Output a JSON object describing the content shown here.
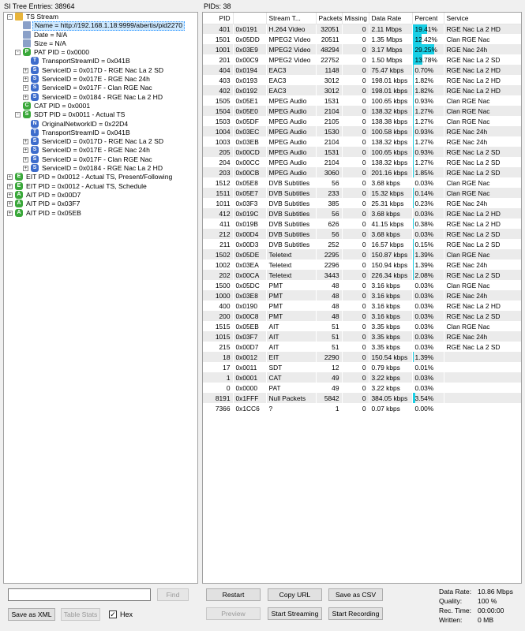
{
  "left_header": "SI Tree Entries: 38964",
  "right_header": "PIDs: 38",
  "tree": [
    {
      "indent": 0,
      "exp": "-",
      "icon": "folder",
      "icon_text": "",
      "label": "TS Stream",
      "name": "tree-ts-stream"
    },
    {
      "indent": 1,
      "exp": "",
      "icon": "doc",
      "icon_text": "",
      "label": "Name = http://192.168.1.18:9999/abertis/pid2270",
      "selected": true,
      "name": "tree-name"
    },
    {
      "indent": 1,
      "exp": "",
      "icon": "doc",
      "icon_text": "",
      "label": "Date = N/A",
      "name": "tree-date"
    },
    {
      "indent": 1,
      "exp": "",
      "icon": "doc",
      "icon_text": "",
      "label": "Size = N/A",
      "name": "tree-size"
    },
    {
      "indent": 1,
      "exp": "-",
      "icon": "green",
      "icon_text": "P",
      "label": "PAT PID = 0x0000",
      "name": "tree-pat"
    },
    {
      "indent": 2,
      "exp": "",
      "icon": "blue",
      "icon_text": "T",
      "label": "TransportStreamID = 0x041B",
      "name": "tree-pat-tsid"
    },
    {
      "indent": 2,
      "exp": "+",
      "icon": "blue",
      "icon_text": "S",
      "label": "ServiceID = 0x017D - RGE Nac La 2 SD",
      "name": "tree-pat-service"
    },
    {
      "indent": 2,
      "exp": "+",
      "icon": "blue",
      "icon_text": "S",
      "label": "ServiceID = 0x017E - RGE Nac 24h",
      "name": "tree-pat-service"
    },
    {
      "indent": 2,
      "exp": "+",
      "icon": "blue",
      "icon_text": "S",
      "label": "ServiceID = 0x017F - Clan RGE Nac",
      "name": "tree-pat-service"
    },
    {
      "indent": 2,
      "exp": "+",
      "icon": "blue",
      "icon_text": "S",
      "label": "ServiceID = 0x0184 - RGE Nac La 2 HD",
      "name": "tree-pat-service"
    },
    {
      "indent": 1,
      "exp": "",
      "icon": "green",
      "icon_text": "C",
      "label": "CAT PID = 0x0001",
      "name": "tree-cat"
    },
    {
      "indent": 1,
      "exp": "-",
      "icon": "green",
      "icon_text": "S",
      "label": "SDT PID = 0x0011 - Actual TS",
      "name": "tree-sdt"
    },
    {
      "indent": 2,
      "exp": "",
      "icon": "blue",
      "icon_text": "N",
      "label": "OriginalNetworkID = 0x22D4",
      "name": "tree-sdt-onid"
    },
    {
      "indent": 2,
      "exp": "",
      "icon": "blue",
      "icon_text": "T",
      "label": "TransportStreamID = 0x041B",
      "name": "tree-sdt-tsid"
    },
    {
      "indent": 2,
      "exp": "+",
      "icon": "blue",
      "icon_text": "S",
      "label": "ServiceID = 0x017D - RGE Nac La 2 SD",
      "name": "tree-sdt-service"
    },
    {
      "indent": 2,
      "exp": "+",
      "icon": "blue",
      "icon_text": "S",
      "label": "ServiceID = 0x017E - RGE Nac 24h",
      "name": "tree-sdt-service"
    },
    {
      "indent": 2,
      "exp": "+",
      "icon": "blue",
      "icon_text": "S",
      "label": "ServiceID = 0x017F - Clan RGE Nac",
      "name": "tree-sdt-service"
    },
    {
      "indent": 2,
      "exp": "+",
      "icon": "blue",
      "icon_text": "S",
      "label": "ServiceID = 0x0184 - RGE Nac La 2 HD",
      "name": "tree-sdt-service"
    },
    {
      "indent": 0,
      "exp": "+",
      "icon": "green",
      "icon_text": "E",
      "label": "EIT PID = 0x0012 - Actual TS, Present/Following",
      "name": "tree-eit-pf"
    },
    {
      "indent": 0,
      "exp": "+",
      "icon": "green",
      "icon_text": "E",
      "label": "EIT PID = 0x0012 - Actual TS, Schedule",
      "name": "tree-eit-schedule"
    },
    {
      "indent": 0,
      "exp": "+",
      "icon": "green",
      "icon_text": "A",
      "label": "AIT PID = 0x00D7",
      "name": "tree-ait"
    },
    {
      "indent": 0,
      "exp": "+",
      "icon": "green",
      "icon_text": "A",
      "label": "AIT PID = 0x03F7",
      "name": "tree-ait"
    },
    {
      "indent": 0,
      "exp": "+",
      "icon": "green",
      "icon_text": "A",
      "label": "AIT PID = 0x05EB",
      "name": "tree-ait"
    }
  ],
  "table": {
    "columns": [
      "PID",
      "",
      "Stream T...",
      "Packets",
      "Missing",
      "Data Rate",
      "Percent",
      "Service"
    ],
    "rows": [
      [
        "401",
        "0x0191",
        "H.264 Video",
        "32051",
        "0",
        "2.11 Mbps",
        "19.41%",
        "RGE Nac La 2 HD"
      ],
      [
        "1501",
        "0x05DD",
        "MPEG2 Video",
        "20511",
        "0",
        "1.35 Mbps",
        "12.42%",
        "Clan RGE Nac"
      ],
      [
        "1001",
        "0x03E9",
        "MPEG2 Video",
        "48294",
        "0",
        "3.17 Mbps",
        "29.25%",
        "RGE Nac 24h"
      ],
      [
        "201",
        "0x00C9",
        "MPEG2 Video",
        "22752",
        "0",
        "1.50 Mbps",
        "13.78%",
        "RGE Nac La 2 SD"
      ],
      [
        "404",
        "0x0194",
        "EAC3",
        "1148",
        "0",
        "75.47 kbps",
        "0.70%",
        "RGE Nac La 2 HD"
      ],
      [
        "403",
        "0x0193",
        "EAC3",
        "3012",
        "0",
        "198.01 kbps",
        "1.82%",
        "RGE Nac La 2 HD"
      ],
      [
        "402",
        "0x0192",
        "EAC3",
        "3012",
        "0",
        "198.01 kbps",
        "1.82%",
        "RGE Nac La 2 HD"
      ],
      [
        "1505",
        "0x05E1",
        "MPEG Audio",
        "1531",
        "0",
        "100.65 kbps",
        "0.93%",
        "Clan RGE Nac"
      ],
      [
        "1504",
        "0x05E0",
        "MPEG Audio",
        "2104",
        "0",
        "138.32 kbps",
        "1.27%",
        "Clan RGE Nac"
      ],
      [
        "1503",
        "0x05DF",
        "MPEG Audio",
        "2105",
        "0",
        "138.38 kbps",
        "1.27%",
        "Clan RGE Nac"
      ],
      [
        "1004",
        "0x03EC",
        "MPEG Audio",
        "1530",
        "0",
        "100.58 kbps",
        "0.93%",
        "RGE Nac 24h"
      ],
      [
        "1003",
        "0x03EB",
        "MPEG Audio",
        "2104",
        "0",
        "138.32 kbps",
        "1.27%",
        "RGE Nac 24h"
      ],
      [
        "205",
        "0x00CD",
        "MPEG Audio",
        "1531",
        "0",
        "100.65 kbps",
        "0.93%",
        "RGE Nac La 2 SD"
      ],
      [
        "204",
        "0x00CC",
        "MPEG Audio",
        "2104",
        "0",
        "138.32 kbps",
        "1.27%",
        "RGE Nac La 2 SD"
      ],
      [
        "203",
        "0x00CB",
        "MPEG Audio",
        "3060",
        "0",
        "201.16 kbps",
        "1.85%",
        "RGE Nac La 2 SD"
      ],
      [
        "1512",
        "0x05E8",
        "DVB Subtitles",
        "56",
        "0",
        "3.68 kbps",
        "0.03%",
        "Clan RGE Nac"
      ],
      [
        "1511",
        "0x05E7",
        "DVB Subtitles",
        "233",
        "0",
        "15.32 kbps",
        "0.14%",
        "Clan RGE Nac"
      ],
      [
        "1011",
        "0x03F3",
        "DVB Subtitles",
        "385",
        "0",
        "25.31 kbps",
        "0.23%",
        "RGE Nac 24h"
      ],
      [
        "412",
        "0x019C",
        "DVB Subtitles",
        "56",
        "0",
        "3.68 kbps",
        "0.03%",
        "RGE Nac La 2 HD"
      ],
      [
        "411",
        "0x019B",
        "DVB Subtitles",
        "626",
        "0",
        "41.15 kbps",
        "0.38%",
        "RGE Nac La 2 HD"
      ],
      [
        "212",
        "0x00D4",
        "DVB Subtitles",
        "56",
        "0",
        "3.68 kbps",
        "0.03%",
        "RGE Nac La 2 SD"
      ],
      [
        "211",
        "0x00D3",
        "DVB Subtitles",
        "252",
        "0",
        "16.57 kbps",
        "0.15%",
        "RGE Nac La 2 SD"
      ],
      [
        "1502",
        "0x05DE",
        "Teletext",
        "2295",
        "0",
        "150.87 kbps",
        "1.39%",
        "Clan RGE Nac"
      ],
      [
        "1002",
        "0x03EA",
        "Teletext",
        "2296",
        "0",
        "150.94 kbps",
        "1.39%",
        "RGE Nac 24h"
      ],
      [
        "202",
        "0x00CA",
        "Teletext",
        "3443",
        "0",
        "226.34 kbps",
        "2.08%",
        "RGE Nac La 2 SD"
      ],
      [
        "1500",
        "0x05DC",
        "PMT",
        "48",
        "0",
        "3.16 kbps",
        "0.03%",
        "Clan RGE Nac"
      ],
      [
        "1000",
        "0x03E8",
        "PMT",
        "48",
        "0",
        "3.16 kbps",
        "0.03%",
        "RGE Nac 24h"
      ],
      [
        "400",
        "0x0190",
        "PMT",
        "48",
        "0",
        "3.16 kbps",
        "0.03%",
        "RGE Nac La 2 HD"
      ],
      [
        "200",
        "0x00C8",
        "PMT",
        "48",
        "0",
        "3.16 kbps",
        "0.03%",
        "RGE Nac La 2 SD"
      ],
      [
        "1515",
        "0x05EB",
        "AIT",
        "51",
        "0",
        "3.35 kbps",
        "0.03%",
        "Clan RGE Nac"
      ],
      [
        "1015",
        "0x03F7",
        "AIT",
        "51",
        "0",
        "3.35 kbps",
        "0.03%",
        "RGE Nac 24h"
      ],
      [
        "215",
        "0x00D7",
        "AIT",
        "51",
        "0",
        "3.35 kbps",
        "0.03%",
        "RGE Nac La 2 SD"
      ],
      [
        "18",
        "0x0012",
        "EIT",
        "2290",
        "0",
        "150.54 kbps",
        "1.39%",
        ""
      ],
      [
        "17",
        "0x0011",
        "SDT",
        "12",
        "0",
        "0.79 kbps",
        "0.01%",
        ""
      ],
      [
        "1",
        "0x0001",
        "CAT",
        "49",
        "0",
        "3.22 kbps",
        "0.03%",
        ""
      ],
      [
        "0",
        "0x0000",
        "PAT",
        "49",
        "0",
        "3.22 kbps",
        "0.03%",
        ""
      ],
      [
        "8191",
        "0x1FFF",
        "Null Packets",
        "5842",
        "0",
        "384.05 kbps",
        "3.54%",
        ""
      ],
      [
        "7366",
        "0x1CC6",
        "?",
        "1",
        "0",
        "0.07 kbps",
        "0.00%",
        ""
      ]
    ]
  },
  "bar_fractions": [
    0.1941,
    0.1242,
    0.2925,
    0.1378,
    0.007,
    0.0182,
    0.0182,
    0.0093,
    0.0127,
    0.0127,
    0.0093,
    0.0127,
    0.0093,
    0.0127,
    0.0185,
    0.0003,
    0.0014,
    0.0023,
    0.0003,
    0.0038,
    0.0003,
    0.0015,
    0.0139,
    0.0139,
    0.0208,
    0.0003,
    0.0003,
    0.0003,
    0.0003,
    0.0003,
    0.0003,
    0.0003,
    0.0139,
    0.0001,
    0.0003,
    0.0003,
    0.0354,
    0
  ],
  "bar_color": "#19d0e6",
  "search": {
    "value": "",
    "find_label": "Find"
  },
  "buttons_left": {
    "save_xml": "Save as XML",
    "table_stats": "Table Stats",
    "hex_label": "Hex",
    "hex_checked": "✓"
  },
  "buttons_right": {
    "restart": "Restart",
    "copy_url": "Copy URL",
    "save_csv": "Save as CSV",
    "preview": "Preview",
    "start_streaming": "Start Streaming",
    "start_recording": "Start Recording"
  },
  "stats": {
    "data_rate_label": "Data Rate:",
    "data_rate": "10.86 Mbps",
    "quality_label": "Quality:",
    "quality": "100 %",
    "rec_time_label": "Rec. Time:",
    "rec_time": "00:00:00",
    "written_label": "Written:",
    "written": "0 MB"
  }
}
